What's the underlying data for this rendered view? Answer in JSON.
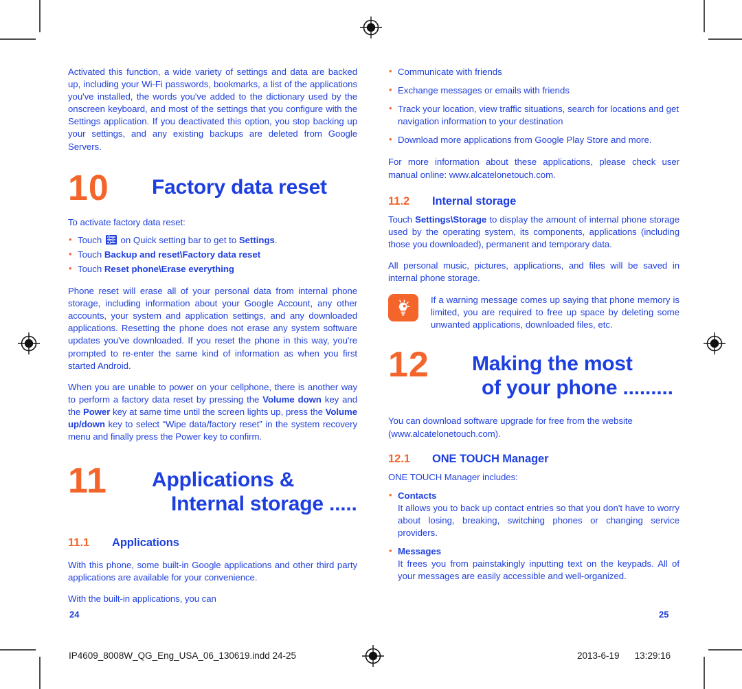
{
  "colors": {
    "blue": "#2040dc",
    "heading_blue": "#1d3fe0",
    "orange": "#f4652b",
    "mark_gray": "#4d4d4d",
    "footer_black": "#1a1a1a"
  },
  "left_page": {
    "intro_paragraph": "Activated this function, a wide variety of settings and data are backed up, including your Wi-Fi passwords, bookmarks, a list of the applications you've installed, the words you've added to the dictionary used by the onscreen keyboard, and most of the settings that you configure with the Settings application. If you deactivated this option, you stop backing up your settings, and any existing backups are deleted from Google Servers.",
    "chapter10": {
      "number": "10",
      "title": "Factory data reset"
    },
    "activate_intro": "To activate factory data reset:",
    "activate_steps": [
      {
        "prefix": "Touch",
        "has_icon": true,
        "icon": "settings-sliders-icon",
        "middle": "on Quick setting bar to get to",
        "bold": "Settings",
        "suffix": "."
      },
      {
        "prefix": "Touch",
        "has_icon": false,
        "bold": "Backup and reset\\Factory data reset",
        "suffix": ""
      },
      {
        "prefix": "Touch",
        "has_icon": false,
        "bold": "Reset phone\\Erase everything",
        "suffix": ""
      }
    ],
    "reset_paragraph": "Phone reset will erase all of your personal data from internal phone storage, including information about your Google Account, any other accounts, your system and application settings, and any downloaded applications. Resetting the phone does not erase any system software updates you've downloaded. If you reset the phone in this way, you're prompted to re-enter the same kind of information as when you first started Android.",
    "recovery_paragraph": {
      "p1": "When you are unable to power on your cellphone, there is another way to perform a factory data reset by pressing the ",
      "b1": "Volume down",
      "p2": " key and the ",
      "b2": "Power",
      "p3": " key at same time until the screen lights up, press the ",
      "b3": "Volume up/down",
      "p4": " key to select “Wipe data/factory reset” in the system recovery menu and finally press the Power key to confirm."
    },
    "chapter11": {
      "number": "11",
      "title_line1": "Applications &",
      "title_line2": "Internal storage ....."
    },
    "section_11_1": {
      "number": "11.1",
      "title": "Applications"
    },
    "applications_paragraph": "With this phone, some built-in Google applications and other third party applications are available for your convenience.",
    "builtin_lead": "With the built-in applications, you can",
    "page_number": "24"
  },
  "right_page": {
    "capability_bullets": [
      "Communicate with friends",
      "Exchange messages or emails with friends",
      "Track your location, view traffic situations, search for locations and get navigation information to your destination",
      "Download more applications from Google Play Store and more."
    ],
    "more_info_paragraph": "For more information about these applications, please check user manual  online: www.alcatelonetouch.com.",
    "section_11_2": {
      "number": "11.2",
      "title": "Internal storage"
    },
    "storage_paragraph": {
      "p1": "Touch ",
      "b1": "Settings\\Storage",
      "p2": " to display the amount of internal phone storage used by the operating system, its components, applications (including those you downloaded), permanent and temporary data."
    },
    "storage_paragraph_2": "All personal music, pictures, applications, and files will be saved in internal phone storage.",
    "tip": {
      "icon": "lightbulb-icon",
      "text": "If a warning message comes up saying that phone memory is limited, you are required to free up space by deleting some unwanted applications, downloaded files, etc."
    },
    "chapter12": {
      "number": "12",
      "title_line1": "Making the most",
      "title_line2": "of your phone ........."
    },
    "download_paragraph": "You can download software upgrade for free from the website (www.alcatelonetouch.com).",
    "section_12_1": {
      "number": "12.1",
      "title": "ONE TOUCH Manager"
    },
    "manager_lead": "ONE TOUCH Manager includes:",
    "manager_items": [
      {
        "label": "Contacts",
        "text": "It allows you to back up contact entries so that you don't have to worry about losing, breaking, switching phones or changing service providers."
      },
      {
        "label": "Messages",
        "text": "It frees you from painstakingly inputting text on the keypads. All of your messages are easily accessible and well-organized."
      }
    ],
    "page_number": "25"
  },
  "footer": {
    "filename": "IP4609_8008W_QG_Eng_USA_06_130619.indd   24-25",
    "date": "2013-6-19",
    "time": "13:29:16"
  }
}
